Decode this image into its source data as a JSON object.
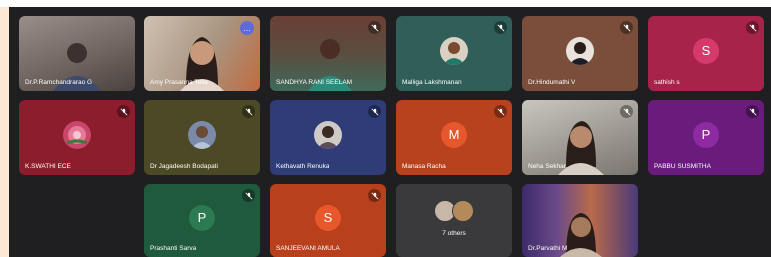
{
  "meeting": {
    "participants": [
      {
        "name": "Dr.P.Ramchandrarao G",
        "type": "camera",
        "tile_color": "#8d8480"
      },
      {
        "name": "Amy Prasanna Tella",
        "type": "camera",
        "tile_color": "#9b8f84",
        "more_icon": "…"
      },
      {
        "name": "SANDHYA RANI SEELAM",
        "type": "camera",
        "tile_color": "#5e4a3f"
      },
      {
        "name": "Malliga Lakshmanan",
        "type": "photo",
        "tile_color": "#2f5f58"
      },
      {
        "name": "Dr.Hindumathi V",
        "type": "photo",
        "tile_color": "#7a4e3a"
      },
      {
        "name": "sathish s",
        "type": "letter",
        "letter": "S",
        "tile_color": "#a8234a",
        "avatar_color": "#d63a6c"
      },
      {
        "name": "K.SWATHI ECE",
        "type": "photo",
        "tile_color": "#8b1d2c"
      },
      {
        "name": "Dr Jagadeesh Bodapati",
        "type": "photo",
        "tile_color": "#4c4a26"
      },
      {
        "name": "Kethavath Renuka",
        "type": "photo",
        "tile_color": "#2f3c78"
      },
      {
        "name": "Manasa Racha",
        "type": "letter",
        "letter": "M",
        "tile_color": "#b8411e",
        "avatar_color": "#e5572d"
      },
      {
        "name": "Neha Sekhar",
        "type": "camera",
        "tile_color": "#8d8a84"
      },
      {
        "name": "PABBU SUSMITHA",
        "type": "letter",
        "letter": "P",
        "tile_color": "#6a1c7c",
        "avatar_color": "#8e2ba3"
      },
      {
        "name": "Prashanti Sarva",
        "type": "letter",
        "letter": "P",
        "tile_color": "#1f5a3c",
        "avatar_color": "#2c7a52"
      },
      {
        "name": "SANJEEVANI AMULA",
        "type": "letter",
        "letter": "S",
        "tile_color": "#b8401d",
        "avatar_color": "#e8582a"
      },
      {
        "name": "7 others",
        "type": "others",
        "tile_color": "#3a3a3d"
      },
      {
        "name": "Dr.Parvathi M",
        "type": "camera",
        "tile_color": "#6b4e7a"
      }
    ]
  }
}
